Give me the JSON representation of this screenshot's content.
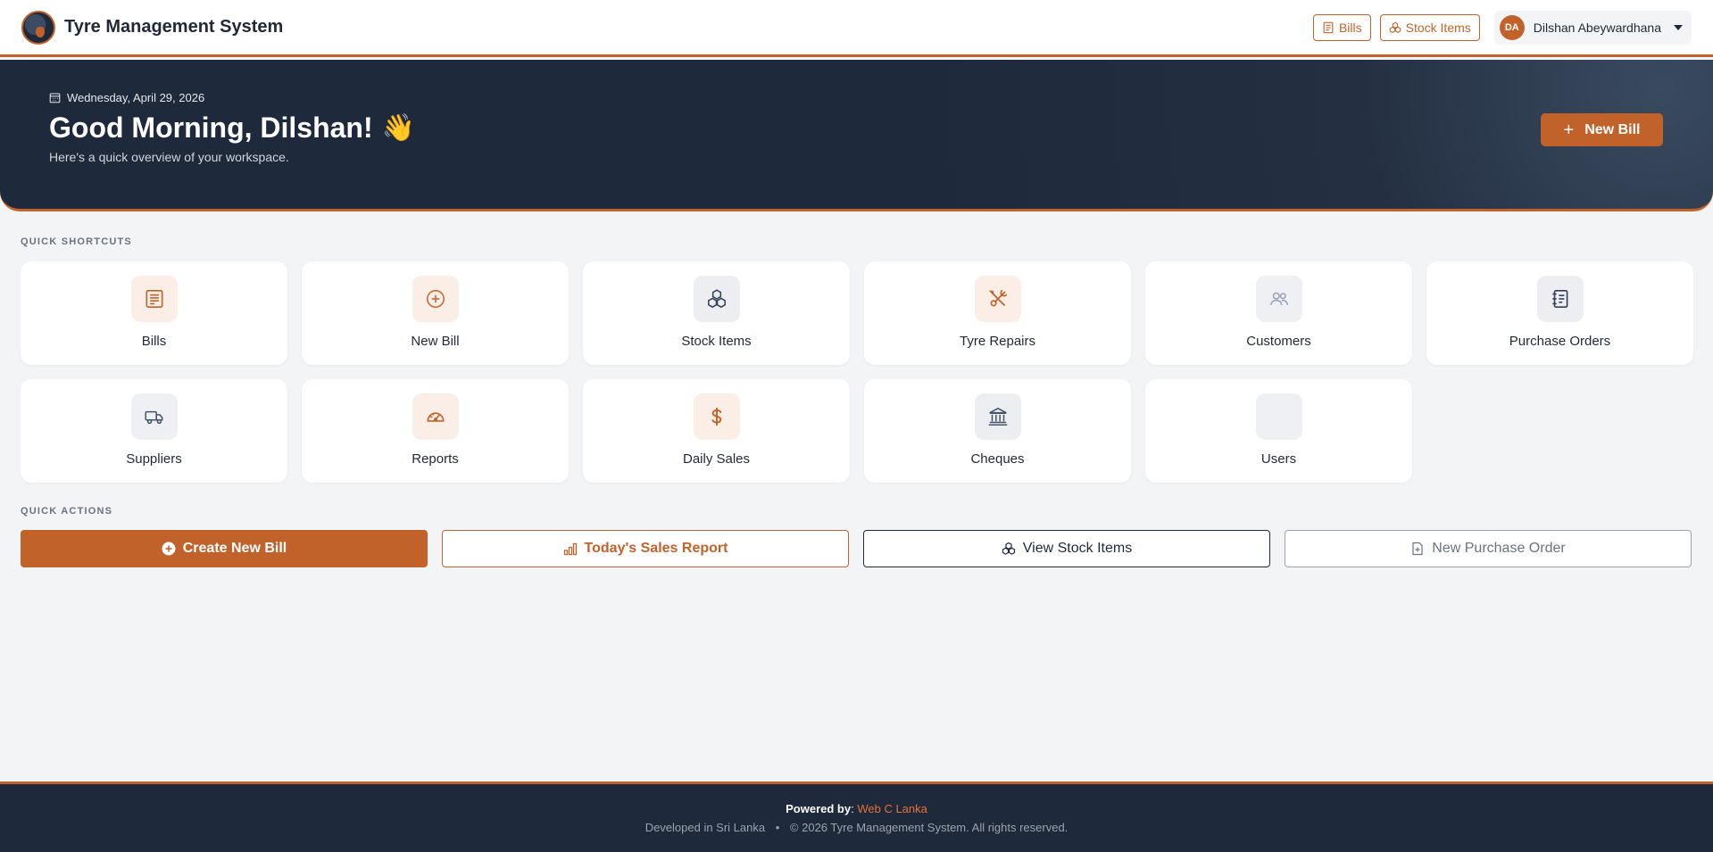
{
  "navbar": {
    "title": "Tyre Management System",
    "bills_label": "Bills",
    "stock_label": "Stock Items",
    "user_initials": "DA",
    "user_name": "Dilshan Abeywardhana"
  },
  "hero": {
    "date": "Wednesday, April 29, 2026",
    "greeting": "Good Morning, Dilshan!",
    "wave": "👋",
    "subtitle": "Here's a quick overview of your workspace.",
    "new_bill_label": "New Bill"
  },
  "shortcuts": {
    "title": "QUICK SHORTCUTS",
    "items": [
      {
        "label": "Bills",
        "icon": "receipt-icon"
      },
      {
        "label": "New Bill",
        "icon": "plus-circle-icon"
      },
      {
        "label": "Stock Items",
        "icon": "boxes-icon"
      },
      {
        "label": "Tyre Repairs",
        "icon": "tools-icon"
      },
      {
        "label": "Customers",
        "icon": "people-icon"
      },
      {
        "label": "Purchase Orders",
        "icon": "journal-icon"
      },
      {
        "label": "Suppliers",
        "icon": "truck-icon"
      },
      {
        "label": "Reports",
        "icon": "speedometer-icon"
      },
      {
        "label": "Daily Sales",
        "icon": "dollar-icon"
      },
      {
        "label": "Cheques",
        "icon": "bank-icon"
      },
      {
        "label": "Users",
        "icon": "users-icon"
      }
    ]
  },
  "actions": {
    "title": "QUICK ACTIONS",
    "create_bill": "Create New Bill",
    "sales_report": "Today's Sales Report",
    "view_stock": "View Stock Items",
    "new_po": "New Purchase Order"
  },
  "footer": {
    "powered_label": "Powered by",
    "powered_sep": ":",
    "powered_link": "Web C Lanka",
    "developed": "Developed in Sri Lanka",
    "bullet": "•",
    "copyright": "© 2026 Tyre Management System. All rights reserved."
  },
  "colors": {
    "accent": "#c2622b",
    "dark": "#1e293b",
    "background": "#f3f4f6"
  }
}
